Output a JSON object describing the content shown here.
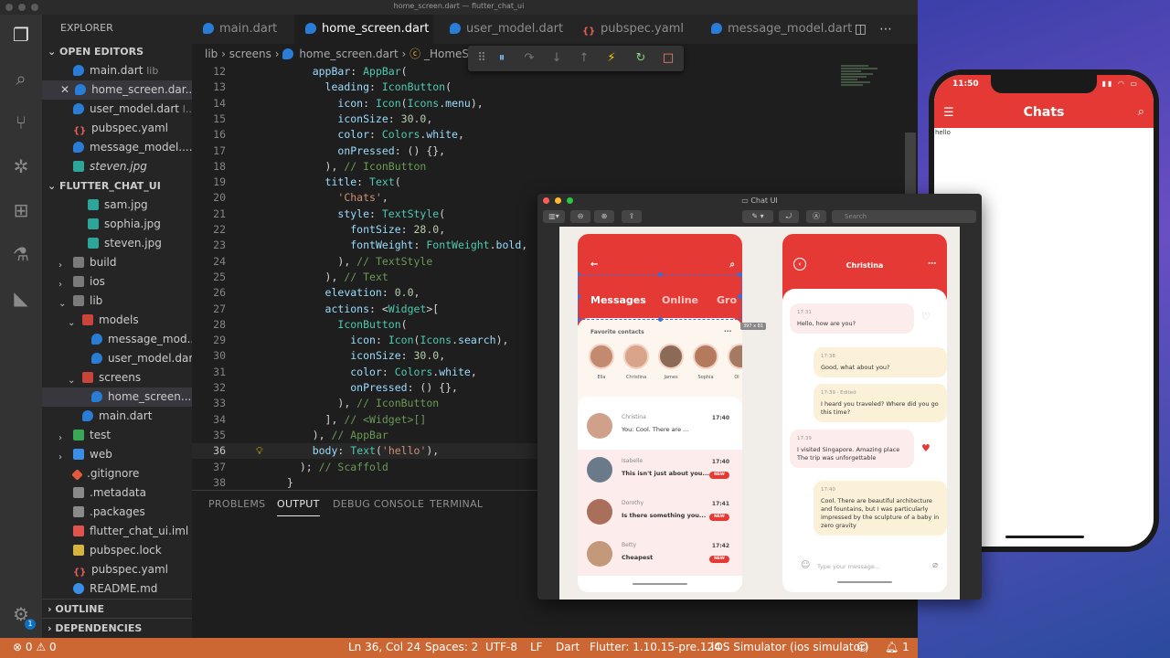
{
  "window": {
    "title": "home_screen.dart — flutter_chat_ui"
  },
  "sidebar": {
    "title": "EXPLORER",
    "open_editors_label": "OPEN EDITORS",
    "open_editors": [
      {
        "name": "main.dart",
        "sub": "lib"
      },
      {
        "name": "home_screen.dar...",
        "sub": ""
      },
      {
        "name": "user_model.dart",
        "sub": "l..."
      },
      {
        "name": "pubspec.yaml",
        "sub": ""
      },
      {
        "name": "message_model....",
        "sub": ""
      },
      {
        "name": "steven.jpg",
        "sub": ""
      }
    ],
    "project_label": "FLUTTER_CHAT_UI",
    "tree": [
      {
        "name": "sam.jpg"
      },
      {
        "name": "sophia.jpg"
      },
      {
        "name": "steven.jpg"
      },
      {
        "name": "build"
      },
      {
        "name": "ios"
      },
      {
        "name": "lib"
      },
      {
        "name": "models"
      },
      {
        "name": "message_mod..."
      },
      {
        "name": "user_model.dart"
      },
      {
        "name": "screens"
      },
      {
        "name": "home_screen...."
      },
      {
        "name": "main.dart"
      },
      {
        "name": "test"
      },
      {
        "name": "web"
      },
      {
        "name": ".gitignore"
      },
      {
        "name": ".metadata"
      },
      {
        "name": ".packages"
      },
      {
        "name": "flutter_chat_ui.iml"
      },
      {
        "name": "pubspec.lock"
      },
      {
        "name": "pubspec.yaml"
      },
      {
        "name": "README.md"
      }
    ],
    "outline_label": "OUTLINE",
    "dependencies_label": "DEPENDENCIES",
    "badge_count": "1"
  },
  "tabs": [
    {
      "label": "main.dart"
    },
    {
      "label": "home_screen.dart"
    },
    {
      "label": "user_model.dart"
    },
    {
      "label": "pubspec.yaml"
    },
    {
      "label": "message_model.dart"
    }
  ],
  "breadcrumb": {
    "lib": "lib",
    "screens": "screens",
    "file": "home_screen.dart",
    "symbol": "_HomeS"
  },
  "editor": {
    "line_numbers": [
      "12",
      "13",
      "14",
      "15",
      "16",
      "17",
      "18",
      "19",
      "20",
      "21",
      "22",
      "23",
      "24",
      "25",
      "26",
      "27",
      "28",
      "29",
      "30",
      "31",
      "32",
      "33",
      "34",
      "35",
      "36",
      "37",
      "38"
    ],
    "current_line": "36"
  },
  "panel": {
    "tabs": [
      "PROBLEMS",
      "OUTPUT",
      "DEBUG CONSOLE",
      "TERMINAL"
    ]
  },
  "status": {
    "errors": "0",
    "warnings": "0",
    "position": "Ln 36, Col 24",
    "spaces": "Spaces: 2",
    "encoding": "UTF-8",
    "eol": "LF",
    "language": "Dart",
    "flutter": "Flutter: 1.10.15-pre.124",
    "device": "iOS Simulator (ios simulator)",
    "notifications": "1"
  },
  "simulator": {
    "time": "11:50",
    "title": "Chats",
    "body": "hello"
  },
  "preview": {
    "title": "Chat UI",
    "search_placeholder": "Search",
    "selection_size": "397 x 81",
    "left_mock": {
      "tabs": [
        "Messages",
        "Online",
        "Gro"
      ],
      "favorites_label": "Favorite contacts",
      "favorites": [
        "Ella",
        "Christina",
        "James",
        "Sophia",
        "Ol"
      ],
      "messages": [
        {
          "name": "Christina",
          "text": "You: Cool. There are ...",
          "time": "17:40",
          "new": ""
        },
        {
          "name": "Isabelle",
          "text": "This isn't just about you...",
          "time": "17:40",
          "new": "NEW"
        },
        {
          "name": "Dorothy",
          "text": "Is there something you...",
          "time": "17:41",
          "new": "NEW"
        },
        {
          "name": "Betty",
          "text": "Cheapest",
          "time": "17:42",
          "new": "NEW"
        }
      ]
    },
    "right_mock": {
      "contact": "Christina",
      "bubbles": [
        {
          "time": "17:31",
          "text": "Hello, how are you?"
        },
        {
          "time": "17:38",
          "text": "Good, what about you?"
        },
        {
          "time": "17:39 · Edited",
          "text": "I heard you traveled? Where did you go this time?"
        },
        {
          "time": "17:39",
          "text": "I visited Singapore. Amazing place The trip was unforgettable"
        },
        {
          "time": "17:40",
          "text": "Cool. There are beautiful architecture and fountains, but I was particularly impressed by the sculpture of a baby in zero gravity"
        }
      ],
      "input_placeholder": "Type your message..."
    }
  }
}
